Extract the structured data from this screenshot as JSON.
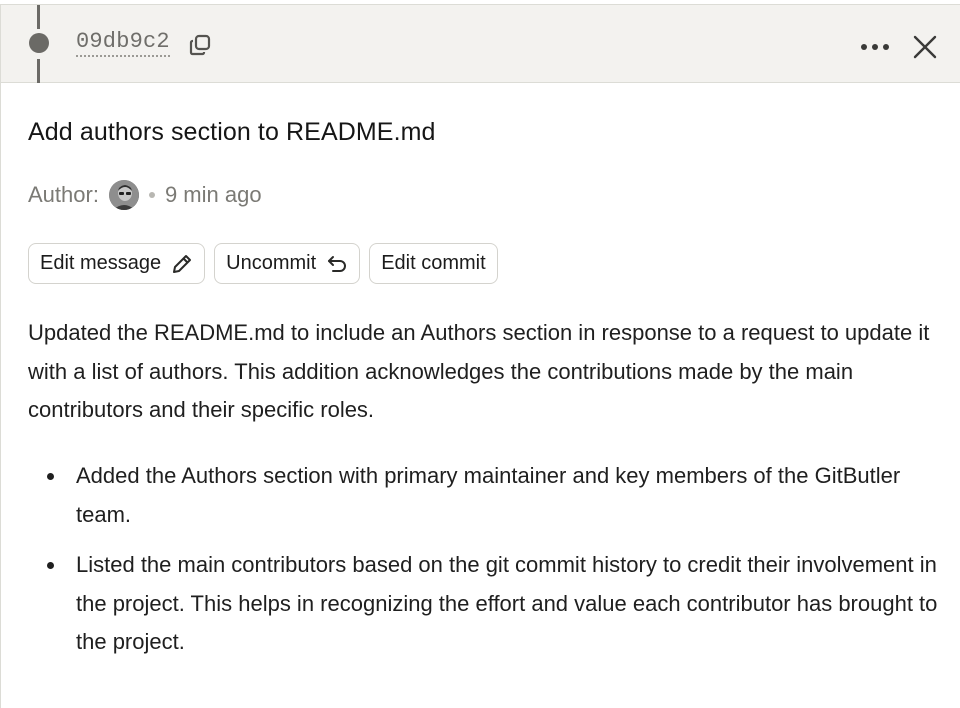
{
  "header": {
    "commit_sha": "09db9c2",
    "copy_icon": "copy-icon",
    "more_icon": "more-horizontal-icon",
    "close_icon": "close-icon"
  },
  "commit": {
    "title": "Add authors section to README.md",
    "author_label": "Author:",
    "time_ago": "9 min ago"
  },
  "actions": {
    "edit_message": "Edit message",
    "uncommit": "Uncommit",
    "edit_commit": "Edit commit"
  },
  "body": {
    "description": "Updated the README.md to include an Authors section in response to a request to update it with a list of authors. This addition acknowledges the contributions made by the main contributors and their specific roles.",
    "bullets": [
      "Added the Authors section with primary maintainer and key members of the GitButler team.",
      "Listed the main contributors based on the git commit history to credit their involvement in the project. This helps in recognizing the effort and value each contributor has brought to the project."
    ]
  },
  "colors": {
    "header_bg": "#f3f2ef",
    "lane": "#6b6a66",
    "muted_text": "#7b7a75",
    "border": "#d4d3ce"
  }
}
